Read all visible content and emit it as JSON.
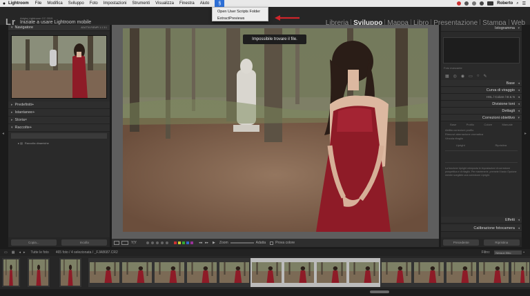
{
  "menubar": {
    "app": "Lightroom",
    "items": [
      "File",
      "Modifica",
      "Sviluppo",
      "Foto",
      "Impostazioni",
      "Strumenti",
      "Visualizza",
      "Finestra",
      "Aiuto"
    ],
    "user": "Roberto"
  },
  "scripts_menu": {
    "items": [
      "Open User Scripts Folder",
      "ExtractPreviews"
    ]
  },
  "identity": {
    "logo": "Lr",
    "version": "Adobe Lightroom CC 2015",
    "title": "Iniziate a usare Lightroom mobile"
  },
  "modules": [
    "Libreria",
    "Sviluppo",
    "Mappa",
    "Libro",
    "Presentazione",
    "Stampa",
    "Web"
  ],
  "active_module": "Sviluppo",
  "left_panel": {
    "navigator": "Navigatore",
    "nav_controls": "ADATTA  RIEMPI  1:1  3:1",
    "sections": [
      "Predefiniti",
      "Istantanee",
      "Storia",
      "Raccolte"
    ],
    "collection_items": [
      "Raccolta dinamiche"
    ],
    "buttons": [
      "Copia...",
      "Incolla"
    ]
  },
  "toast": "Impossibile trovare il file.",
  "toolbar": {
    "zoom": "Zoom",
    "fit": "Adatta",
    "soft_proof": "Prova colore"
  },
  "right_panel": {
    "histogram": "Istogramma",
    "missing": "Foto mancante",
    "sections": [
      "Base",
      "Curva di viraggio",
      "HSL / Colore / B & N",
      "Divisione toni",
      "Dettagli",
      "Correzioni obiettivo"
    ],
    "lens_tabs": [
      "Base",
      "Profilo",
      "Colore",
      "Manuale"
    ],
    "lens_checks": [
      "Abilita correzioni profilo",
      "Rimuovi aberrazione cromatica",
      "Vincola ritaglio"
    ],
    "upright_label": "Upright",
    "reset_label": "Ripristina",
    "note": "La funzione Upright reimposta le impostazioni di correzione prospettica e di ritaglio. Per mantenerle, premete il tasto Opzione mentre scegliete una correzione Upright.",
    "lower_sections": [
      "Effetti",
      "Calibrazione fotocamera"
    ],
    "buttons": [
      "Precedente",
      "Ripristina"
    ]
  },
  "filmstrip": {
    "source": "Tutte le foto",
    "count": "465 foto / 4 selezionata / _FJA8687.CR2",
    "filter": "Filtro:",
    "filter_value": "Nessun filtro",
    "thumb_count": 17
  },
  "colors": {
    "accent_blue": "#2d6fd6",
    "arrow_red": "#d0252b",
    "dress": "#8e1b27",
    "panel": "#2a2a2a"
  }
}
